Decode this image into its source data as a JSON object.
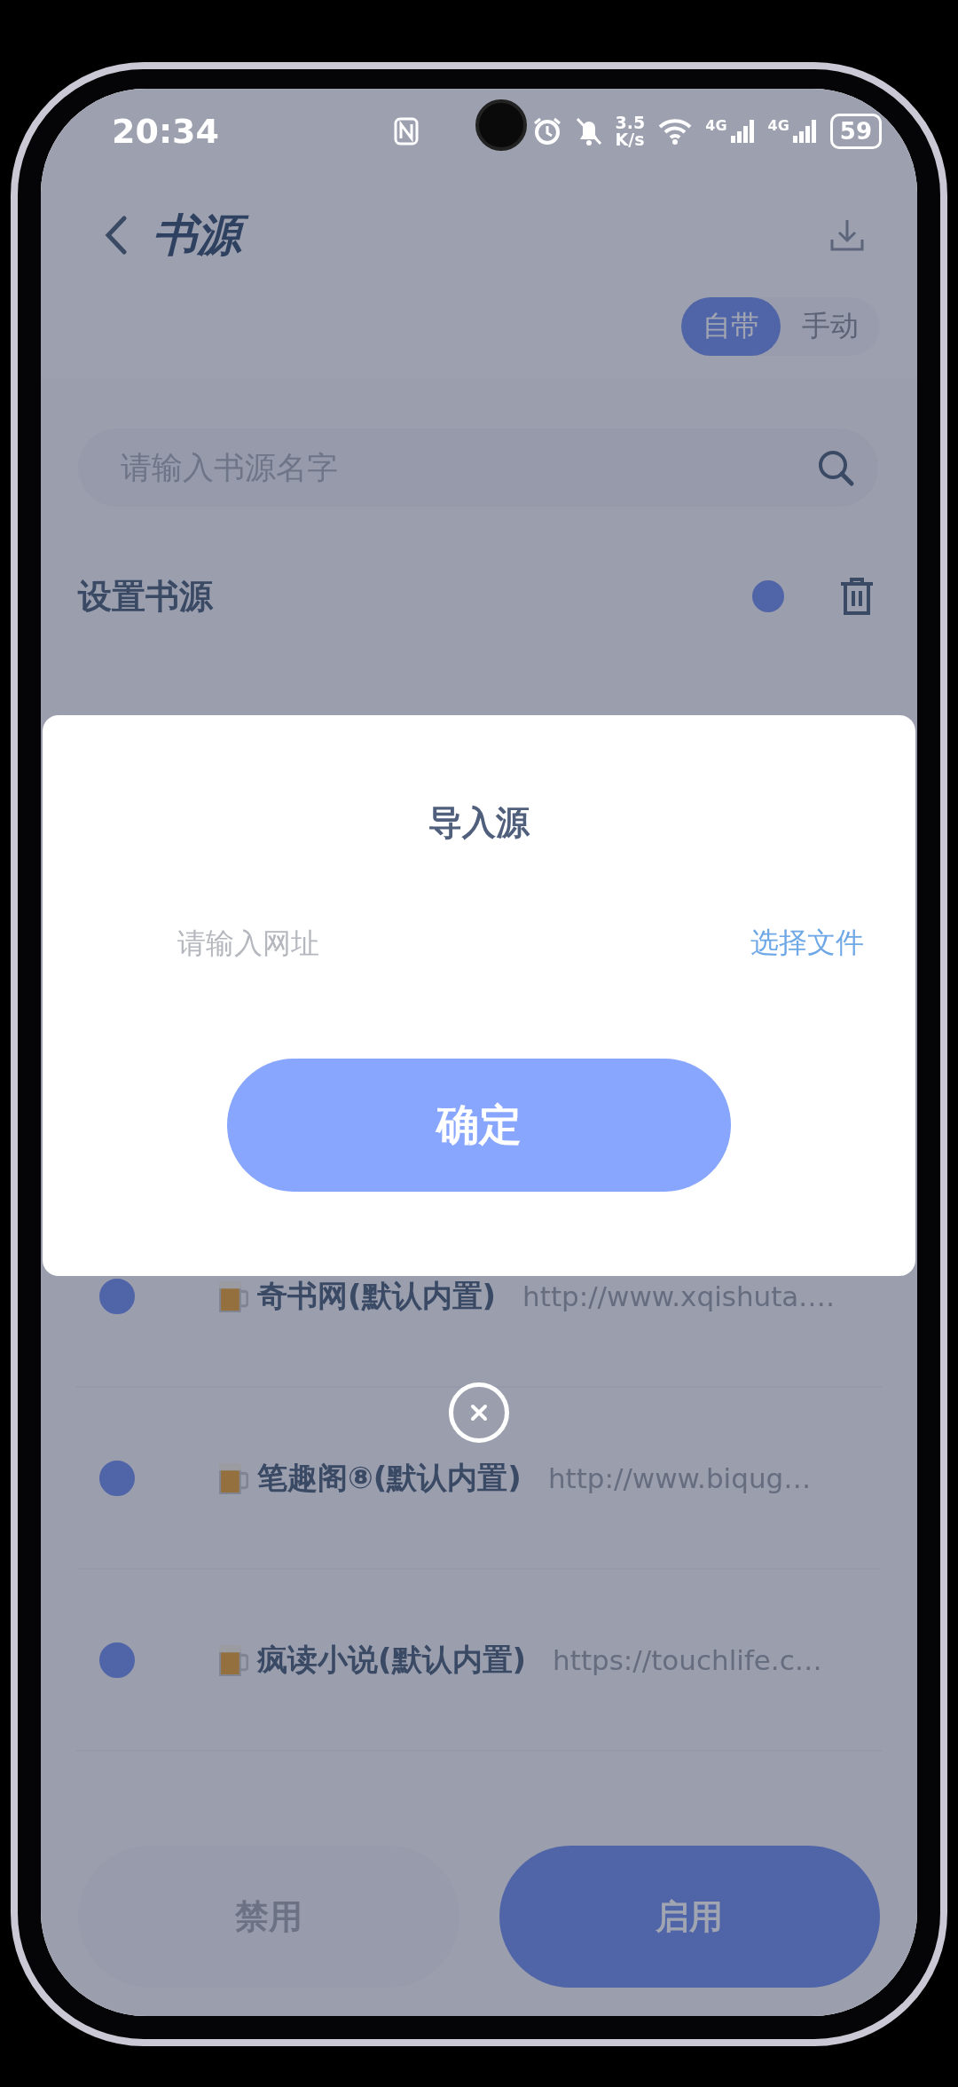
{
  "status_bar": {
    "time": "20:34",
    "net_speed": [
      "3.5",
      "K/s"
    ],
    "signals": [
      "4G",
      "4G"
    ],
    "battery": "59"
  },
  "header": {
    "title": "书源"
  },
  "tabs": [
    {
      "label": "自带",
      "selected": true
    },
    {
      "label": "手动",
      "selected": false
    }
  ],
  "search": {
    "placeholder": "请输入书源名字"
  },
  "settings": {
    "label": "设置书源",
    "checked": true
  },
  "sources": [
    {
      "name": "奇书网(默认内置)",
      "url": "http://www.xqishuta.…",
      "checked": true
    },
    {
      "name": "笔趣阁⑧(默认内置)",
      "url": "http://www.biqug…",
      "checked": true
    },
    {
      "name": "疯读小说(默认内置)",
      "url": "https://touchlife.c…",
      "checked": true
    }
  ],
  "actions": [
    {
      "label": "禁用",
      "kind": "secondary"
    },
    {
      "label": "启用",
      "kind": "primary"
    }
  ],
  "dialog": {
    "title": "导入源",
    "url_field": {
      "placeholder": "请输入网址"
    },
    "file_link": "选择文件",
    "confirm": "确定"
  }
}
